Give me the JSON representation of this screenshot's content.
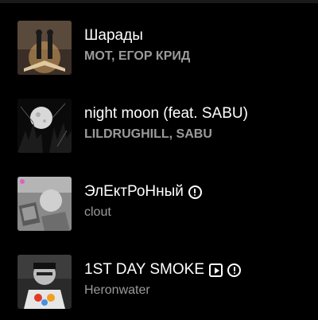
{
  "tracks": [
    {
      "title": "Шарады",
      "artist": "МОТ, ЕГОР КРИД",
      "cover_icon": "album-cover-book",
      "badges": []
    },
    {
      "title": "night moon (feat. SABU)",
      "artist": "LILDRUGHILL, SABU",
      "cover_icon": "album-cover-moon",
      "badges": []
    },
    {
      "title": "ЭлЕктРоНный",
      "artist": "clout",
      "cover_icon": "album-cover-photo",
      "badges": [
        "explicit-icon"
      ]
    },
    {
      "title": "1ST DAY SMOKE",
      "artist": "Heronwater",
      "cover_icon": "album-cover-portrait",
      "badges": [
        "video-icon",
        "explicit-icon"
      ]
    }
  ],
  "colors": {
    "background": "#000000",
    "title": "#ffffff",
    "artist": "#9b9b9b"
  }
}
